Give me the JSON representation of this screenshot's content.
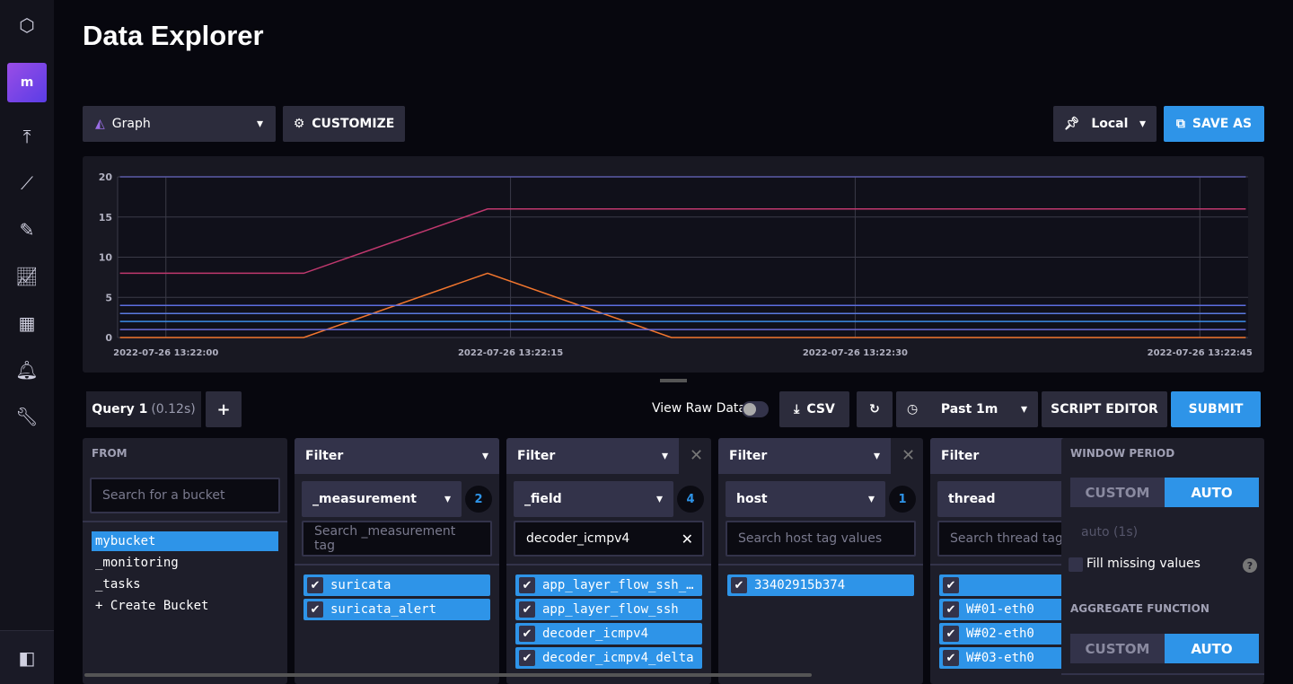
{
  "page": {
    "title": "Data Explorer",
    "org_initial": "m"
  },
  "sidebar": {
    "icons": [
      "logo-icon",
      "upload-icon",
      "data-explorer-icon",
      "notebook-icon",
      "dashboards-icon",
      "tasks-icon",
      "alerts-icon",
      "settings-wrench-icon"
    ],
    "collapse_icon": "collapse-sidebar-icon"
  },
  "toolbar": {
    "vis_type": "Graph",
    "customize": "CUSTOMIZE",
    "timezone": "Local",
    "save_as": "SAVE AS"
  },
  "chart_data": {
    "type": "line",
    "xlabel": "",
    "ylabel": "",
    "ylim": [
      0,
      20
    ],
    "yticks": [
      "0",
      "5",
      "10",
      "15",
      "20"
    ],
    "xticks": [
      "2022-07-26 13:22:00",
      "2022-07-26 13:22:15",
      "2022-07-26 13:22:30",
      "2022-07-26 13:22:45"
    ],
    "xlim_seconds": [
      "13:21:57.9",
      "13:22:47.1"
    ],
    "grid": true,
    "series": [
      {
        "color": "#c0386e",
        "points": [
          [
            "13:21:58",
            8
          ],
          [
            "13:22:06",
            8
          ],
          [
            "13:22:14",
            16
          ],
          [
            "13:22:47",
            16
          ]
        ]
      },
      {
        "color": "#f2762e",
        "points": [
          [
            "13:21:58",
            0
          ],
          [
            "13:22:06",
            0
          ],
          [
            "13:22:14",
            8
          ],
          [
            "13:22:22",
            0
          ],
          [
            "13:22:47",
            0
          ]
        ]
      },
      {
        "color": "#5c6ee0",
        "points": [
          [
            "13:21:58",
            4
          ],
          [
            "13:22:47",
            4
          ]
        ]
      },
      {
        "color": "#5a7ae0",
        "points": [
          [
            "13:21:58",
            3
          ],
          [
            "13:22:47",
            3
          ]
        ]
      },
      {
        "color": "#3c8de8",
        "points": [
          [
            "13:21:58",
            2
          ],
          [
            "13:22:47",
            2
          ]
        ]
      },
      {
        "color": "#6c6cd8",
        "points": [
          [
            "13:21:58",
            1
          ],
          [
            "13:22:47",
            1
          ]
        ]
      },
      {
        "color": "#5a5aa8",
        "points": [
          [
            "13:21:58",
            20
          ],
          [
            "13:22:47",
            20
          ]
        ]
      }
    ]
  },
  "query": {
    "tab": "Query 1",
    "time": "(0.12s)",
    "add": "+",
    "view_raw": "View Raw Data",
    "csv": "CSV",
    "range": "Past 1m",
    "script_editor": "SCRIPT EDITOR",
    "submit": "SUBMIT"
  },
  "from": {
    "title": "FROM",
    "placeholder": "Search for a bucket",
    "buckets": [
      "mybucket",
      "_monitoring",
      "_tasks",
      "+ Create Bucket"
    ]
  },
  "filters": [
    {
      "head": "Filter",
      "key": "_measurement",
      "count": "2",
      "placeholder": "Search _measurement tag",
      "values": [
        "suricata",
        "suricata_alert"
      ]
    },
    {
      "head": "Filter",
      "key": "_field",
      "count": "4",
      "search_value": "decoder_icmpv4",
      "values": [
        "app_layer_flow_ssh_…",
        "app_layer_flow_ssh",
        "decoder_icmpv4",
        "decoder_icmpv4_delta"
      ]
    },
    {
      "head": "Filter",
      "key": "host",
      "count": "1",
      "placeholder": "Search host tag values",
      "values": [
        "33402915b374"
      ]
    },
    {
      "head": "Filter",
      "key": "thread",
      "placeholder": "Search thread tag values",
      "values": [
        "",
        "W#01-eth0",
        "W#02-eth0",
        "W#03-eth0"
      ]
    }
  ],
  "window": {
    "title": "WINDOW PERIOD",
    "custom": "CUSTOM",
    "auto": "AUTO",
    "auto_value": "auto (1s)",
    "fill_missing": "Fill missing values",
    "help": "?",
    "agg_title": "AGGREGATE FUNCTION"
  }
}
